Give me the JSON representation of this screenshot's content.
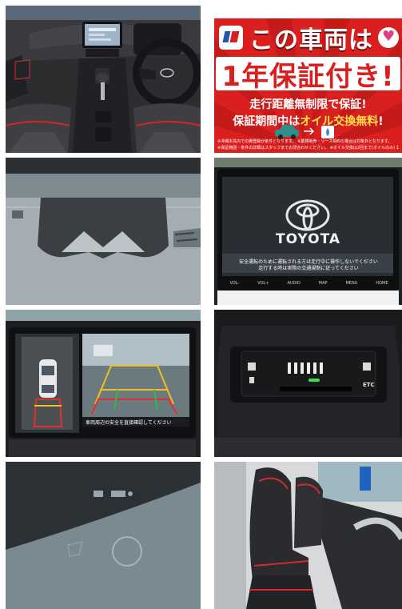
{
  "gallery": {
    "tiles": [
      {
        "subject": "interior-dashboard"
      },
      {
        "subject": "warranty-banner"
      },
      {
        "subject": "windshield-camera"
      },
      {
        "subject": "navigation-screen"
      },
      {
        "subject": "panoramic-camera-screen"
      },
      {
        "subject": "etc-unit"
      },
      {
        "subject": "windshield-sensor"
      },
      {
        "subject": "front-seats"
      }
    ]
  },
  "promo": {
    "title_line1": "この車両は",
    "title_line2": "1年保証付き!",
    "line1": "走行距離無制限で保証!",
    "line2_pre": "保証期間中は",
    "line2_highlight": "オイル交換無料",
    "line2_post": "!",
    "fine_print1": "※沖縄本島内での御登録が条件となります。 ※業務販売・リース契約の場合は対象外となります。",
    "fine_print2": "※保証範囲・条件の詳細はスタッフまでお問合わせください。 ※オイル交換は2回まで(オイルのみ) 1回/半年。",
    "colors": {
      "background": "#d9201e",
      "ray": "#c41a19",
      "highlight": "#ffe04a"
    }
  },
  "nav": {
    "brand": "TOYOTA",
    "notice1": "安全運転のために運転される方は走行中に操作しないでください",
    "notice2": "走行する時は実際の交通規制に従ってください",
    "buttons": [
      "VOL-",
      "VOL+",
      "AUDIO",
      "MAP",
      "MENU",
      "HOME"
    ]
  },
  "camera": {
    "notice": "車両周辺の安全を直接確認してください"
  },
  "etc": {
    "label": "ETC"
  }
}
